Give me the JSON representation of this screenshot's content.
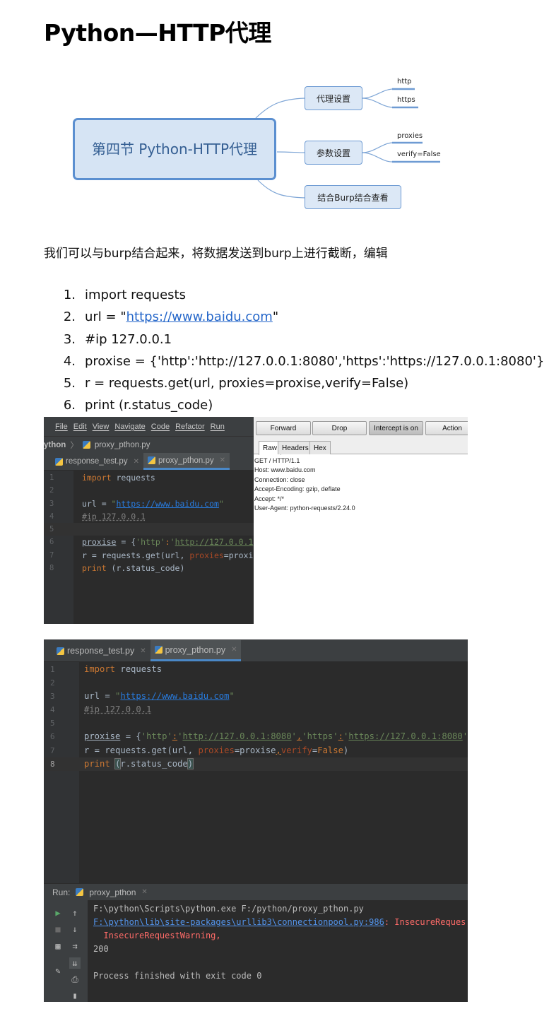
{
  "title": "Python—HTTP代理",
  "mindmap": {
    "root": "第四节 Python-HTTP代理",
    "nodes": [
      {
        "label": "代理设置",
        "leaves": [
          "http",
          "https"
        ]
      },
      {
        "label": "参数设置",
        "leaves": [
          "proxies",
          "verify=False"
        ]
      },
      {
        "label": "结合Burp结合查看",
        "leaves": []
      }
    ]
  },
  "paragraph": "我们可以与burp结合起来，将数据发送到burp上进行截断，编辑",
  "code_list": [
    {
      "num": "1.",
      "before": "import requests",
      "link": "",
      "after": ""
    },
    {
      "num": "2.",
      "before": "url = \"",
      "link": "https://www.baidu.com",
      "after": "\""
    },
    {
      "num": "3.",
      "before": "#ip 127.0.0.1",
      "link": "",
      "after": ""
    },
    {
      "num": "4.",
      "before": "proxise = {'http':'http://127.0.0.1:8080','https':'https://127.0.0.1:8080'}",
      "link": "",
      "after": ""
    },
    {
      "num": "5.",
      "before": "r = requests.get(url, proxies=proxise,verify=False)",
      "link": "",
      "after": ""
    },
    {
      "num": "6.",
      "before": "print (r.status_code)",
      "link": "",
      "after": ""
    }
  ],
  "ide1": {
    "menu": [
      "File",
      "Edit",
      "View",
      "Navigate",
      "Code",
      "Refactor",
      "Run"
    ],
    "breadcrumb_project": "ython",
    "breadcrumb_sep": "〉",
    "breadcrumb_file": "proxy_pthon.py",
    "tabs": [
      "response_test.py",
      "proxy_pthon.py"
    ],
    "line_numbers": [
      "1",
      "2",
      "3",
      "4",
      "5",
      "6",
      "7",
      "8"
    ],
    "code": {
      "l1_kw": "import",
      "l1_rest": " requests",
      "l3_a": "url = ",
      "l3_q1": "\"",
      "l3_url": "https://www.baidu.com",
      "l3_q2": "\"",
      "l4": "#ip 127.0.0.1",
      "l6_var": "proxise",
      "l6_a": " = {",
      "l6_s1": "'http'",
      "l6_colon": ":",
      "l6_s2": "'",
      "l6_url": "http://127.0.0.1",
      "l7_a": "r = requests.get(url, ",
      "l7_p": "proxies",
      "l7_b": "=proxi",
      "l8_kw": "print",
      "l8_rest": " (r.status_code)"
    }
  },
  "burp": {
    "buttons": [
      "Forward",
      "Drop",
      "Intercept is on",
      "Action"
    ],
    "tabs": [
      "Raw",
      "Headers",
      "Hex"
    ],
    "request": [
      "GET / HTTP/1.1",
      "Host: www.baidu.com",
      "Connection: close",
      "Accept-Encoding: gzip, deflate",
      "Accept: */*",
      "User-Agent: python-requests/2.24.0"
    ]
  },
  "ide2": {
    "tabs": [
      "response_test.py",
      "proxy_pthon.py"
    ],
    "line_numbers": [
      "1",
      "2",
      "3",
      "4",
      "5",
      "6",
      "7",
      "8"
    ],
    "code": {
      "l1_kw": "import",
      "l1_rest": " requests",
      "l3_a": "url = ",
      "l3_q1": "\"",
      "l3_url": "https://www.baidu.com",
      "l3_q2": "\"",
      "l4": "#ip 127.0.0.1",
      "l6_var": "proxise",
      "l6_a": " = {",
      "l6_s1": "'http'",
      "l6_colon": ":",
      "l6_s2q": "'",
      "l6_url1": "http://127.0.0.1:8080",
      "l6_s2e": "'",
      "l6_comma": ",",
      "l6_s3": "'https'",
      "l6_colon2": ":",
      "l6_s4q": "'",
      "l6_url2": "https://127.0.0.1:8080",
      "l6_s4e": "'",
      "l6_end": "}",
      "l7_a": "r = requests.get(url, ",
      "l7_p": "proxies",
      "l7_b": "=proxise",
      "l7_c": ",",
      "l7_v": "verify",
      "l7_eq": "=",
      "l7_f": "False",
      "l7_end": ")",
      "l8_kw": "print",
      "l8_sp": " ",
      "l8_open": "(",
      "l8_mid": "r.status_code",
      "l8_close": ")"
    },
    "run_label": "Run:",
    "run_config": "proxy_pthon",
    "console": {
      "cmd": "F:\\python\\Scripts\\python.exe F:/python/proxy_pthon.py",
      "warn_link": "F:\\python\\lib\\site-packages\\urllib3\\connectionpool.py:986",
      "warn_text": ": InsecureReques",
      "warn2": "  InsecureRequestWarning,",
      "status": "200",
      "exit": "Process finished with exit code 0"
    }
  }
}
